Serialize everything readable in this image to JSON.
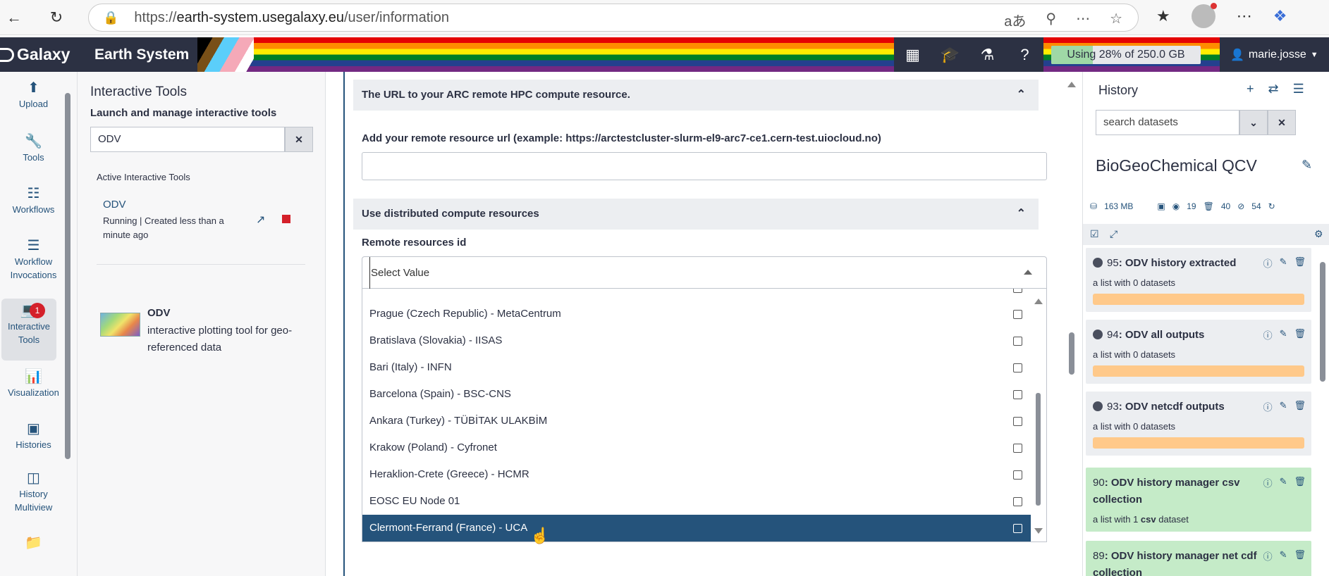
{
  "browser": {
    "url_prefix": "https://",
    "url_host": "earth-system.usegalaxy.eu",
    "url_path": "/user/information"
  },
  "masthead": {
    "brand": "Galaxy",
    "subtitle": "Earth System",
    "quota_text": "Using 28% of 250.0 GB",
    "quota_percent": 28,
    "user": "marie.josse"
  },
  "activity": {
    "upload": "Upload",
    "tools": "Tools",
    "workflows": "Workflows",
    "invocations_1": "Workflow",
    "invocations_2": "Invocations",
    "interactive_1": "Interactive",
    "interactive_2": "Tools",
    "interactive_badge": "1",
    "visualization": "Visualization",
    "histories": "Histories",
    "multiview_1": "History",
    "multiview_2": "Multiview"
  },
  "tool_panel": {
    "title": "Interactive Tools",
    "subtitle": "Launch and manage interactive tools",
    "search_value": "ODV",
    "active_heading": "Active Interactive Tools",
    "active_tool_name": "ODV",
    "active_tool_status": "Running | Created less than a minute ago",
    "tool_name": "ODV",
    "tool_description": "interactive plotting tool for geo-referenced data"
  },
  "form": {
    "section1_title": "The URL to your ARC remote HPC compute resource.",
    "field1_label": "Add your remote resource url (example: https://arctestcluster-slurm-el9-arc7-ce1.cern-test.uiocloud.no)",
    "field1_value": "",
    "section2_title": "Use distributed compute resources",
    "field2_label": "Remote resources id",
    "select_placeholder": "Select Value",
    "options": [
      "Prague (Czech Republic) - MetaCentrum",
      "Bratislava (Slovakia) - IISAS",
      "Bari (Italy) - INFN",
      "Barcelona (Spain) - BSC-CNS",
      "Ankara (Turkey) - TÜBİTAK ULAKBİM",
      "Krakow (Poland) - Cyfronet",
      "Heraklion-Crete (Greece) - HCMR",
      "EOSC EU Node 01",
      "Clermont-Ferrand (France) - UCA"
    ],
    "selected_option": "Clermont-Ferrand (France) - UCA"
  },
  "history": {
    "title": "History",
    "search_placeholder": "search datasets",
    "name": "BioGeoChemical QCV",
    "size": "163 MB",
    "count_shown": "19",
    "count_deleted": "40",
    "count_hidden": "54",
    "items": [
      {
        "hid": "95",
        "name": "ODV history extracted",
        "sub": "a list with 0 datasets",
        "state": "queued"
      },
      {
        "hid": "94",
        "name": "ODV all outputs",
        "sub": "a list with 0 datasets",
        "state": "queued"
      },
      {
        "hid": "93",
        "name": "ODV netcdf outputs",
        "sub": "a list with 0 datasets",
        "state": "queued"
      },
      {
        "hid": "90",
        "name": "ODV history manager csv collection",
        "sub_prefix": "a list with 1 ",
        "sub_bold": "csv",
        "sub_suffix": " dataset",
        "state": "ok"
      },
      {
        "hid": "89",
        "name": "ODV history manager net cdf collection",
        "state": "ok"
      }
    ]
  }
}
